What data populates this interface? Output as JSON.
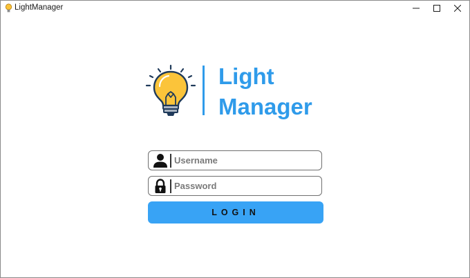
{
  "window": {
    "title": "LightManager",
    "controls": {
      "minimize": "—",
      "maximize": "☐",
      "close": "✕"
    }
  },
  "logo": {
    "line1": "Light",
    "line2": "Manager",
    "bulb_icon": "lightbulb-icon",
    "accent_color": "#2f9bea",
    "bulb_color": "#fbc43a"
  },
  "login_form": {
    "username": {
      "placeholder": "Username",
      "value": "",
      "icon": "user-icon"
    },
    "password": {
      "placeholder": "Password",
      "value": "",
      "icon": "lock-icon"
    },
    "login_label": "LOGIN",
    "button_color": "#38a3f5"
  }
}
